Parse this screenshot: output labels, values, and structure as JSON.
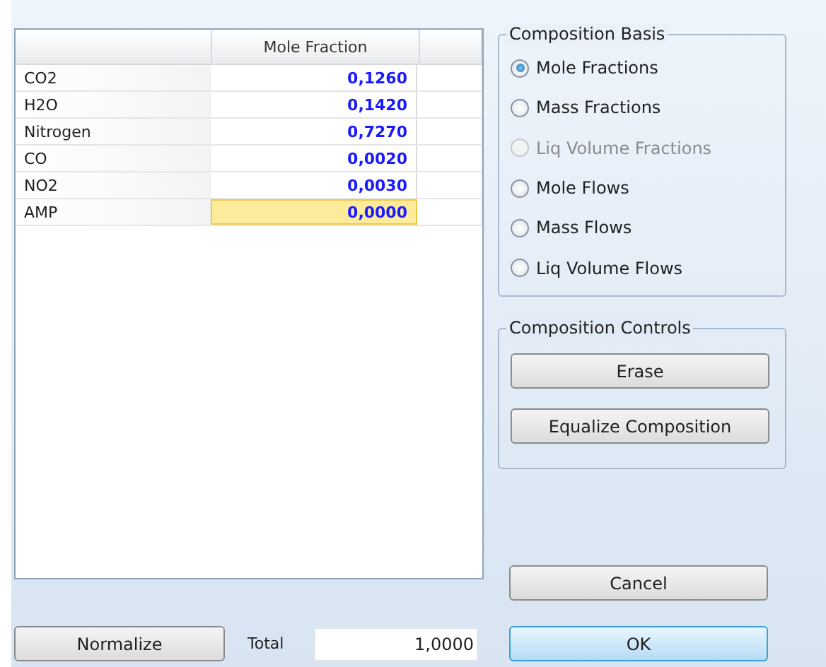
{
  "grid": {
    "columns": [
      "Mole Fraction"
    ],
    "rows": [
      {
        "name": "CO2",
        "value": "0,1260",
        "selected": false
      },
      {
        "name": "H2O",
        "value": "0,1420",
        "selected": false
      },
      {
        "name": "Nitrogen",
        "value": "0,7270",
        "selected": false
      },
      {
        "name": "CO",
        "value": "0,0020",
        "selected": false
      },
      {
        "name": "NO2",
        "value": "0,0030",
        "selected": false
      },
      {
        "name": "AMP",
        "value": "0,0000",
        "selected": true
      }
    ]
  },
  "composition_basis": {
    "title": "Composition Basis",
    "options": [
      {
        "label": "Mole Fractions",
        "selected": true,
        "disabled": false
      },
      {
        "label": "Mass Fractions",
        "selected": false,
        "disabled": false
      },
      {
        "label": "Liq Volume Fractions",
        "selected": false,
        "disabled": true
      },
      {
        "label": "Mole Flows",
        "selected": false,
        "disabled": false
      },
      {
        "label": "Mass Flows",
        "selected": false,
        "disabled": false
      },
      {
        "label": "Liq Volume Flows",
        "selected": false,
        "disabled": false
      }
    ]
  },
  "composition_controls": {
    "title": "Composition Controls",
    "buttons": [
      "Erase",
      "Equalize Composition"
    ]
  },
  "normalize_button": "Normalize",
  "total": {
    "label": "Total",
    "value": "1,0000"
  },
  "cancel_button": "Cancel",
  "ok_button": "OK"
}
